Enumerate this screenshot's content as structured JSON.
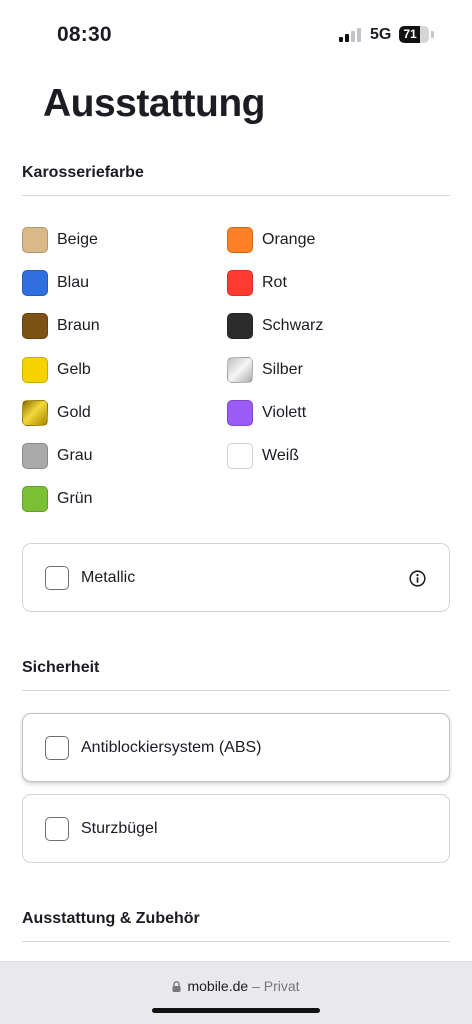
{
  "status_bar": {
    "time": "08:30",
    "network": "5G",
    "battery_level": "71",
    "battery_fraction": 0.71,
    "signal_bars_active": 2,
    "signal_bars_total": 4
  },
  "page": {
    "title": "Ausstattung"
  },
  "sections": {
    "body_color": {
      "title": "Karosseriefarbe",
      "colors": [
        {
          "label": "Beige",
          "swatch": "#dbb888"
        },
        {
          "label": "Blau",
          "swatch": "#2f6fe0"
        },
        {
          "label": "Braun",
          "swatch": "#7d5214"
        },
        {
          "label": "Gelb",
          "swatch": "#f5d200"
        },
        {
          "label": "Gold",
          "swatch": "linear-gradient(135deg,#8a6a00 0%,#f2d93a 45%,#a98400 100%)"
        },
        {
          "label": "Grau",
          "swatch": "#aaaaaa"
        },
        {
          "label": "Grün",
          "swatch": "#7abf34"
        },
        {
          "label": "Orange",
          "swatch": "#ff7f27"
        },
        {
          "label": "Rot",
          "swatch": "#ff3b30"
        },
        {
          "label": "Schwarz",
          "swatch": "#2c2c2c"
        },
        {
          "label": "Silber",
          "swatch": "linear-gradient(135deg,#bdbdbd 0%,#f6f6f6 50%,#a9a9a9 100%)"
        },
        {
          "label": "Violett",
          "swatch": "#9b5cf6"
        },
        {
          "label": "Weiß",
          "swatch": "#ffffff"
        }
      ],
      "metallic_label": "Metallic"
    },
    "safety": {
      "title": "Sicherheit",
      "options": [
        {
          "label": "Antiblockiersystem (ABS)",
          "checked": false
        },
        {
          "label": "Sturzbügel",
          "checked": false
        }
      ]
    },
    "equipment": {
      "title": "Ausstattung & Zubehör"
    }
  },
  "browser": {
    "host": "mobile.de",
    "separator": "–",
    "mode": "Privat"
  }
}
